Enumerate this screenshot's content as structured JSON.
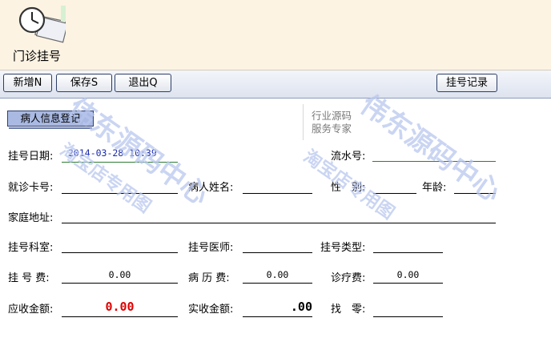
{
  "app": {
    "title": "门诊挂号"
  },
  "toolbar": {
    "new_label": "新增N",
    "save_label": "保存S",
    "exit_label": "退出Q",
    "records_label": "挂号记录"
  },
  "section": {
    "title": "病人信息登记"
  },
  "side_note": {
    "line1": "行业源码",
    "line2": "服务专家"
  },
  "form": {
    "reg_date_label": "挂号日期:",
    "reg_date_value": "2014-03-28 10:39",
    "serial_label": "流水号:",
    "serial_value": "",
    "card_label": "就诊卡号:",
    "card_value": "",
    "name_label": "病人姓名:",
    "name_value": "",
    "gender_label": "性　别:",
    "gender_value": "",
    "age_label": "年龄:",
    "age_value": "",
    "address_label": "家庭地址:",
    "address_value": "",
    "dept_label": "挂号科室:",
    "dept_value": "",
    "doctor_label": "挂号医师:",
    "doctor_value": "",
    "type_label": "挂号类型:",
    "type_value": "",
    "fee_label": "挂 号 费:",
    "fee_value": "0.00",
    "record_fee_label": "病 历 费:",
    "record_fee_value": "0.00",
    "consult_fee_label": "诊疗费:",
    "consult_fee_value": "0.00",
    "receivable_label": "应收金额:",
    "receivable_value": "0.00",
    "received_label": "实收金额:",
    "received_value": ".00",
    "change_label": "找　零:",
    "change_value": ""
  },
  "watermark": {
    "text1": "伟东源码中心",
    "text2": "淘宝店专用图"
  },
  "colors": {
    "receivable": "#e00000",
    "date_value": "#1a2aa8",
    "serial_underline": "#2e7d32",
    "tab_bg": "#a9b9e2"
  }
}
